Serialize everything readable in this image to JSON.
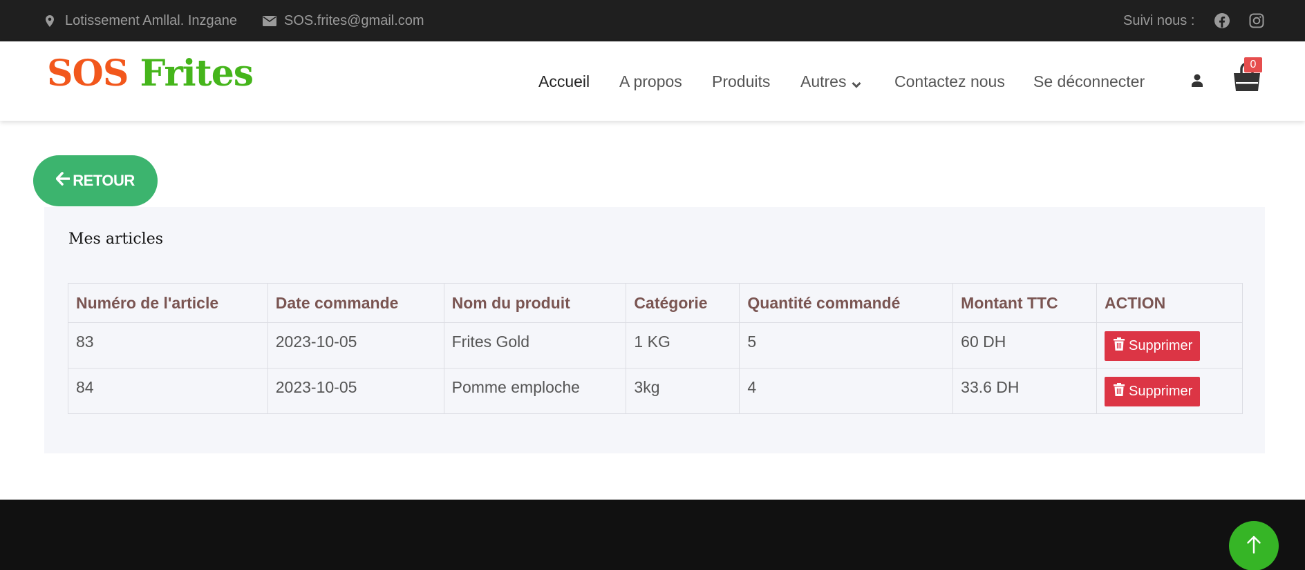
{
  "topbar": {
    "address": "Lotissement Amllal. Inzgane",
    "email": "SOS.frites@gmail.com",
    "follow_label": "Suivi nous :",
    "icons": [
      "map-marker-icon",
      "envelope-icon",
      "facebook-icon",
      "instagram-icon"
    ]
  },
  "brand": {
    "part1": "SOS",
    "part2": "Frites",
    "colors": {
      "part1": "#f2571c",
      "part2": "#45b51b"
    }
  },
  "nav": {
    "items": [
      {
        "label": "Accueil",
        "active": true
      },
      {
        "label": "A propos"
      },
      {
        "label": "Produits"
      },
      {
        "label": "Autres",
        "dropdown": true
      },
      {
        "label": "Contactez nous"
      },
      {
        "label": "Se déconnecter"
      }
    ],
    "cart_count": "0"
  },
  "back_button": {
    "label": "RETOUR",
    "icon": "arrow-left-icon",
    "color": "#3cb46e"
  },
  "articles": {
    "title": "Mes articles",
    "headers": [
      "Numéro de l'article",
      "Date commande",
      "Nom du produit",
      "Catégorie",
      "Quantité commandé",
      "Montant TTC",
      "ACTION"
    ],
    "rows": [
      {
        "numero": "83",
        "date": "2023-10-05",
        "produit": "Frites Gold",
        "categorie": "1 KG",
        "quantite": "5",
        "montant": "60 DH",
        "action": "Supprimer"
      },
      {
        "numero": "84",
        "date": "2023-10-05",
        "produit": "Pomme emploche",
        "categorie": "3kg",
        "quantite": "4",
        "montant": "33.6 DH",
        "action": "Supprimer"
      }
    ],
    "action_color": "#dc3545"
  },
  "scroll_top": {
    "icon": "arrow-up-icon",
    "color": "#36b526"
  }
}
